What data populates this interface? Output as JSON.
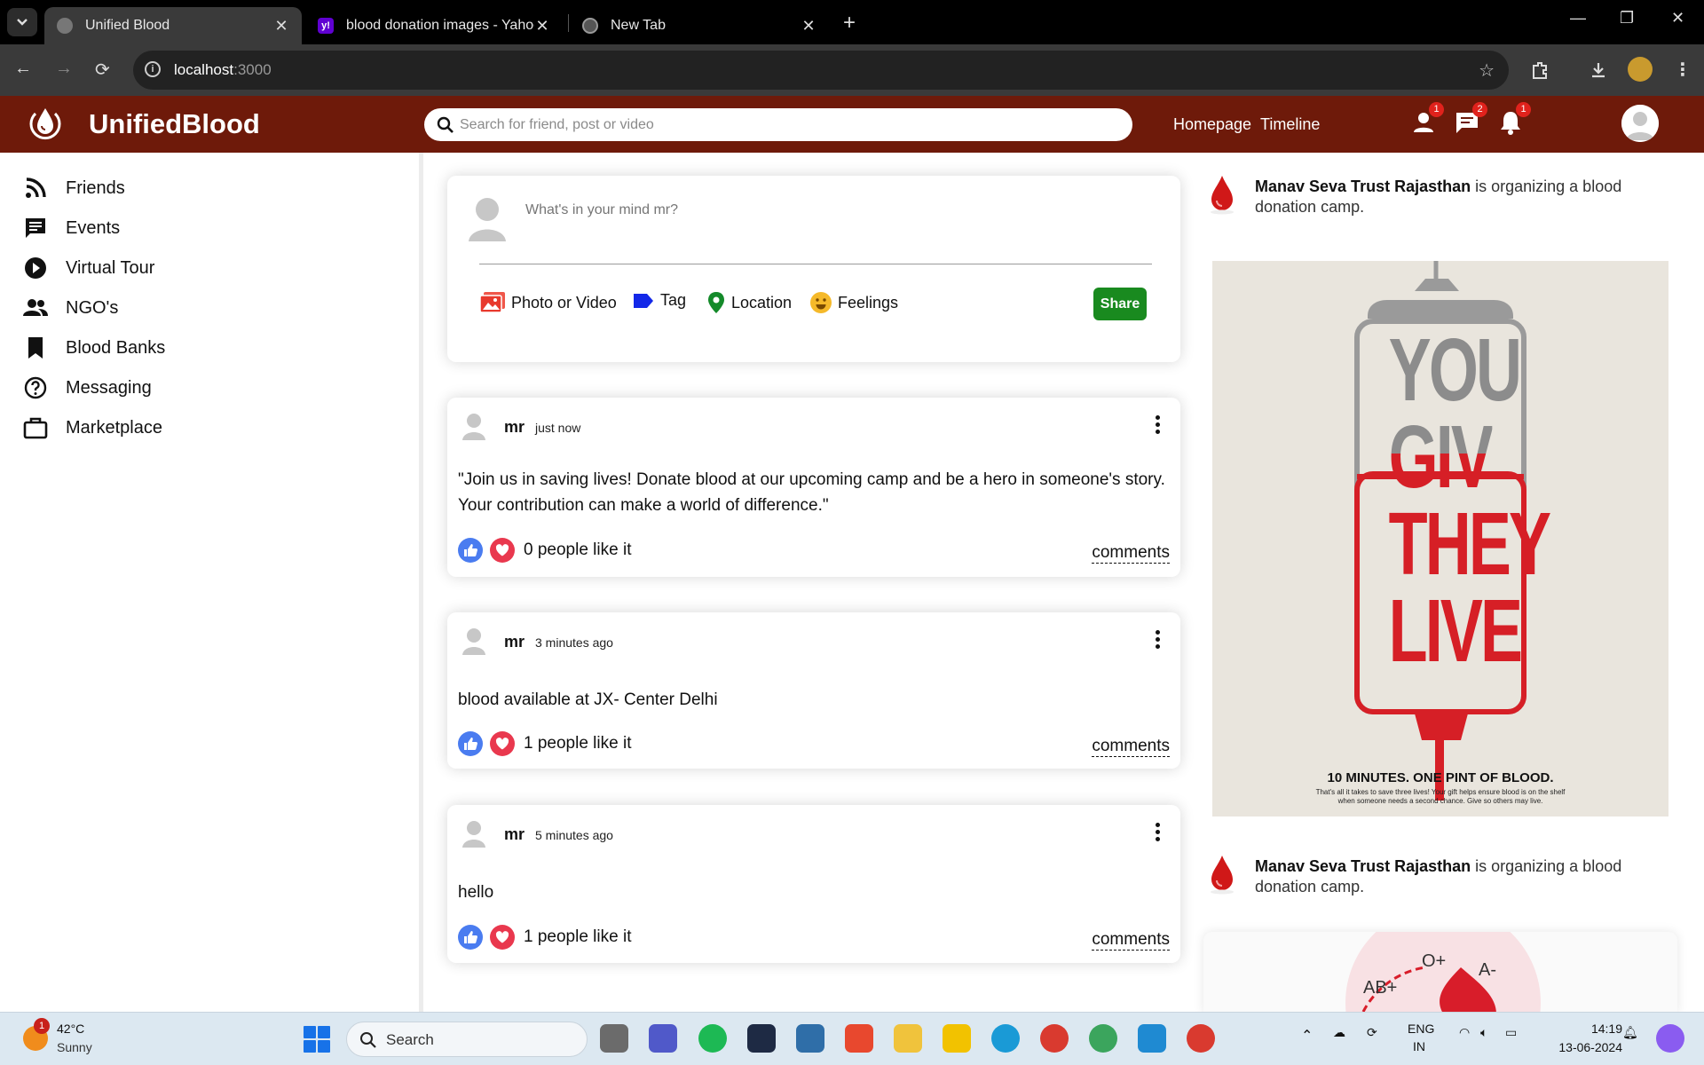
{
  "browser": {
    "tabs": [
      {
        "title": "Unified Blood",
        "active": true
      },
      {
        "title": "blood donation images - Yahoo",
        "active": false
      },
      {
        "title": "New Tab",
        "active": false
      }
    ],
    "url_host": "localhost",
    "url_port": ":3000"
  },
  "app": {
    "brand": "UnifiedBlood",
    "search_placeholder": "Search for friend, post or video",
    "nav": {
      "homepage": "Homepage",
      "timeline": "Timeline"
    },
    "badges": {
      "friends": "1",
      "messages": "2",
      "notifications": "1"
    },
    "colors": {
      "header": "#6e1a0a",
      "share_button": "#198a1f",
      "like_blue": "#4a7cf0",
      "heart_red": "#e9384e"
    }
  },
  "sidebar": {
    "items": [
      {
        "label": "Friends",
        "icon": "rss-icon"
      },
      {
        "label": "Events",
        "icon": "chat-icon"
      },
      {
        "label": "Virtual Tour",
        "icon": "play-circle-icon"
      },
      {
        "label": "NGO's",
        "icon": "group-icon"
      },
      {
        "label": "Blood Banks",
        "icon": "bookmark-icon"
      },
      {
        "label": "Messaging",
        "icon": "help-circle-icon"
      },
      {
        "label": "Marketplace",
        "icon": "briefcase-icon"
      }
    ]
  },
  "share": {
    "placeholder": "What's in your mind mr?",
    "options": {
      "photo": "Photo or Video",
      "tag": "Tag",
      "location": "Location",
      "feelings": "Feelings"
    },
    "button": "Share"
  },
  "posts": [
    {
      "user": "mr",
      "time": "just now",
      "text": "\"Join us in saving lives! Donate blood at our upcoming camp and be a hero in someone's story. Your contribution can make a world of difference.\"",
      "likes": "0 people like it",
      "comments": "comments"
    },
    {
      "user": "mr",
      "time": "3 minutes ago",
      "text": "blood available at JX- Center Delhi",
      "likes": "1 people like it",
      "comments": "comments"
    },
    {
      "user": "mr",
      "time": "5 minutes ago",
      "text": "hello",
      "likes": "1 people like it",
      "comments": "comments"
    }
  ],
  "rail": {
    "items": [
      {
        "org": "Manav Seva Trust Rajasthan",
        "text": " is organizing a blood donation camp."
      },
      {
        "org": "Manav Seva Trust Rajasthan",
        "text": " is organizing a blood donation camp."
      }
    ],
    "poster1": {
      "line1": "YOU",
      "line2": "GIVE",
      "line3": "THEY",
      "line4": "LIVE",
      "caption": "10 MINUTES. ONE PINT OF BLOOD.",
      "small1": "That's all it takes to save three lives! Your gift helps ensure blood is on the shelf",
      "small2": "when someone needs a second chance. Give so others may live."
    },
    "poster2": {
      "t1": "O+",
      "t2": "A-",
      "t3": "AB+"
    }
  },
  "taskbar": {
    "weather_badge": "1",
    "temp": "42°C",
    "condition": "Sunny",
    "search": "Search",
    "lang1": "ENG",
    "lang2": "IN",
    "time": "14:19",
    "date": "13-06-2024"
  }
}
